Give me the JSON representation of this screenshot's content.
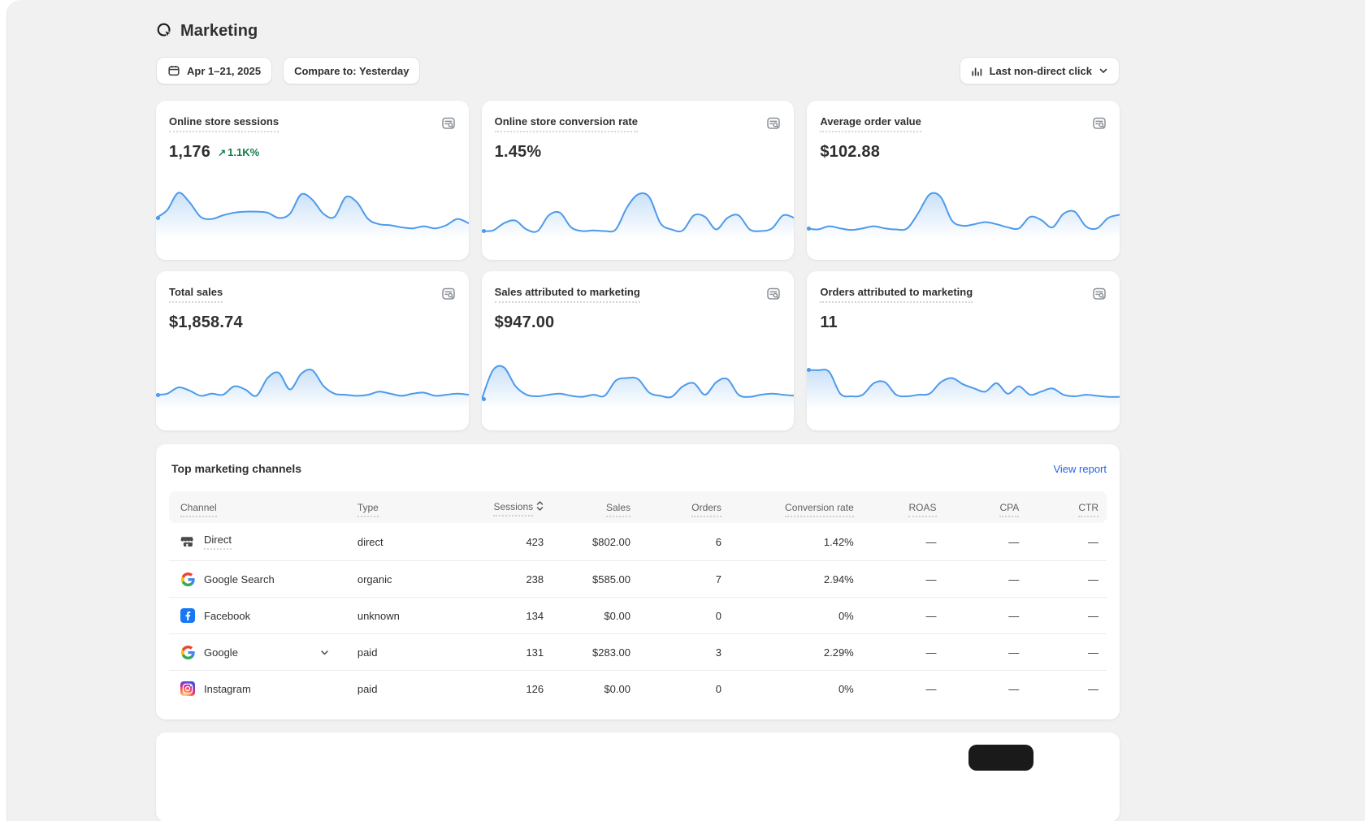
{
  "page": {
    "title": "Marketing"
  },
  "toolbar": {
    "date_range": "Apr 1–21, 2025",
    "compare": "Compare to: Yesterday",
    "attribution_model": "Last non-direct click"
  },
  "colors": {
    "link_blue": "#2463eb",
    "success_green": "#177a4c",
    "sparkline_blue": "#4d9aea",
    "page_background": "#f1f1f1"
  },
  "metric_cards": [
    {
      "title": "Online store sessions",
      "value": "1,176",
      "change": "1.1K%",
      "change_direction": "up",
      "spark": [
        40,
        55,
        88,
        70,
        42,
        38,
        45,
        50,
        52,
        52,
        50,
        40,
        48,
        85,
        75,
        48,
        42,
        80,
        70,
        38,
        28,
        26,
        22,
        20,
        24,
        20,
        26,
        38,
        30
      ]
    },
    {
      "title": "Online store conversion rate",
      "value": "1.45%",
      "spark": [
        15,
        16,
        30,
        35,
        18,
        15,
        45,
        50,
        22,
        15,
        16,
        15,
        18,
        60,
        85,
        80,
        30,
        18,
        16,
        45,
        42,
        18,
        40,
        45,
        18,
        15,
        20,
        45,
        40
      ]
    },
    {
      "title": "Average order value",
      "value": "$102.88",
      "spark": [
        20,
        18,
        24,
        20,
        17,
        20,
        24,
        20,
        18,
        20,
        50,
        85,
        80,
        35,
        25,
        28,
        32,
        28,
        22,
        20,
        42,
        36,
        22,
        48,
        52,
        24,
        20,
        40,
        46
      ]
    },
    {
      "title": "Total sales",
      "value": "$1,858.74",
      "spark": [
        28,
        30,
        42,
        36,
        26,
        30,
        28,
        44,
        38,
        26,
        60,
        70,
        38,
        68,
        75,
        45,
        30,
        28,
        26,
        28,
        34,
        30,
        26,
        30,
        32,
        26,
        28,
        30,
        28
      ]
    },
    {
      "title": "Sales attributed to marketing",
      "value": "$947.00",
      "spark": [
        20,
        75,
        80,
        45,
        28,
        25,
        28,
        30,
        26,
        24,
        28,
        26,
        55,
        60,
        58,
        32,
        26,
        24,
        44,
        50,
        28,
        52,
        58,
        28,
        24,
        28,
        30,
        28,
        26
      ]
    },
    {
      "title": "Orders attributed to marketing",
      "value": "11",
      "spark": [
        75,
        75,
        72,
        30,
        25,
        28,
        50,
        52,
        28,
        25,
        28,
        30,
        52,
        60,
        48,
        40,
        34,
        50,
        30,
        44,
        28,
        34,
        40,
        28,
        25,
        28,
        26,
        24,
        24
      ]
    }
  ],
  "channels_table": {
    "title": "Top marketing channels",
    "view_report": "View report",
    "columns": {
      "channel": "Channel",
      "type": "Type",
      "sessions": "Sessions",
      "sales": "Sales",
      "orders": "Orders",
      "conversion_rate": "Conversion rate",
      "roas": "ROAS",
      "cpa": "CPA",
      "ctr": "CTR"
    },
    "rows": [
      {
        "channel": "Direct",
        "icon": "storefront-icon",
        "type": "direct",
        "sessions": "423",
        "sales": "$802.00",
        "orders": "6",
        "conversion_rate": "1.42%",
        "roas": "—",
        "cpa": "—",
        "ctr": "—"
      },
      {
        "channel": "Google Search",
        "icon": "google-icon",
        "type": "organic",
        "sessions": "238",
        "sales": "$585.00",
        "orders": "7",
        "conversion_rate": "2.94%",
        "roas": "—",
        "cpa": "—",
        "ctr": "—"
      },
      {
        "channel": "Facebook",
        "icon": "facebook-icon",
        "type": "unknown",
        "sessions": "134",
        "sales": "$0.00",
        "orders": "0",
        "conversion_rate": "0%",
        "roas": "—",
        "cpa": "—",
        "ctr": "—"
      },
      {
        "channel": "Google",
        "icon": "google-icon",
        "expandable": true,
        "type": "paid",
        "sessions": "131",
        "sales": "$283.00",
        "orders": "3",
        "conversion_rate": "2.29%",
        "roas": "—",
        "cpa": "—",
        "ctr": "—"
      },
      {
        "channel": "Instagram",
        "icon": "instagram-icon",
        "type": "paid",
        "sessions": "126",
        "sales": "$0.00",
        "orders": "0",
        "conversion_rate": "0%",
        "roas": "—",
        "cpa": "—",
        "ctr": "—"
      }
    ]
  }
}
